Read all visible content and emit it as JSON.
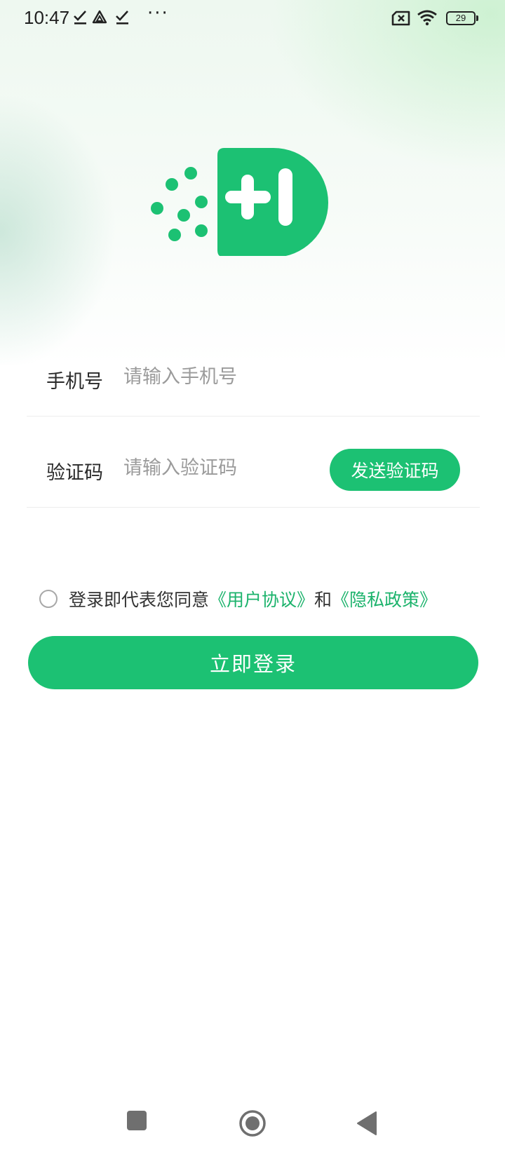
{
  "status_bar": {
    "time": "10:47",
    "overflow": "···",
    "battery_level": "29",
    "icons": [
      "check-download-icon",
      "drive-icon",
      "check-download-icon",
      "no-sim-icon",
      "wifi-icon",
      "battery-icon"
    ]
  },
  "logo": {
    "icon": "app-logo-icon",
    "color": "#1cc173"
  },
  "form": {
    "phone": {
      "label": "手机号",
      "value": "",
      "placeholder": "请输入手机号"
    },
    "code": {
      "label": "验证码",
      "value": "",
      "placeholder": "请输入验证码",
      "send_button": "发送验证码"
    }
  },
  "agreement": {
    "checked": false,
    "prefix": "登录即代表您同意",
    "user_agreement": "《用户协议》",
    "conjunction": "和",
    "privacy_policy": "《隐私政策》"
  },
  "login_button": "立即登录",
  "nav_bar": {
    "icons": [
      "recents-square-icon",
      "home-circle-icon",
      "back-triangle-icon"
    ]
  },
  "colors": {
    "accent": "#1cc173",
    "link": "#1cb36c"
  }
}
